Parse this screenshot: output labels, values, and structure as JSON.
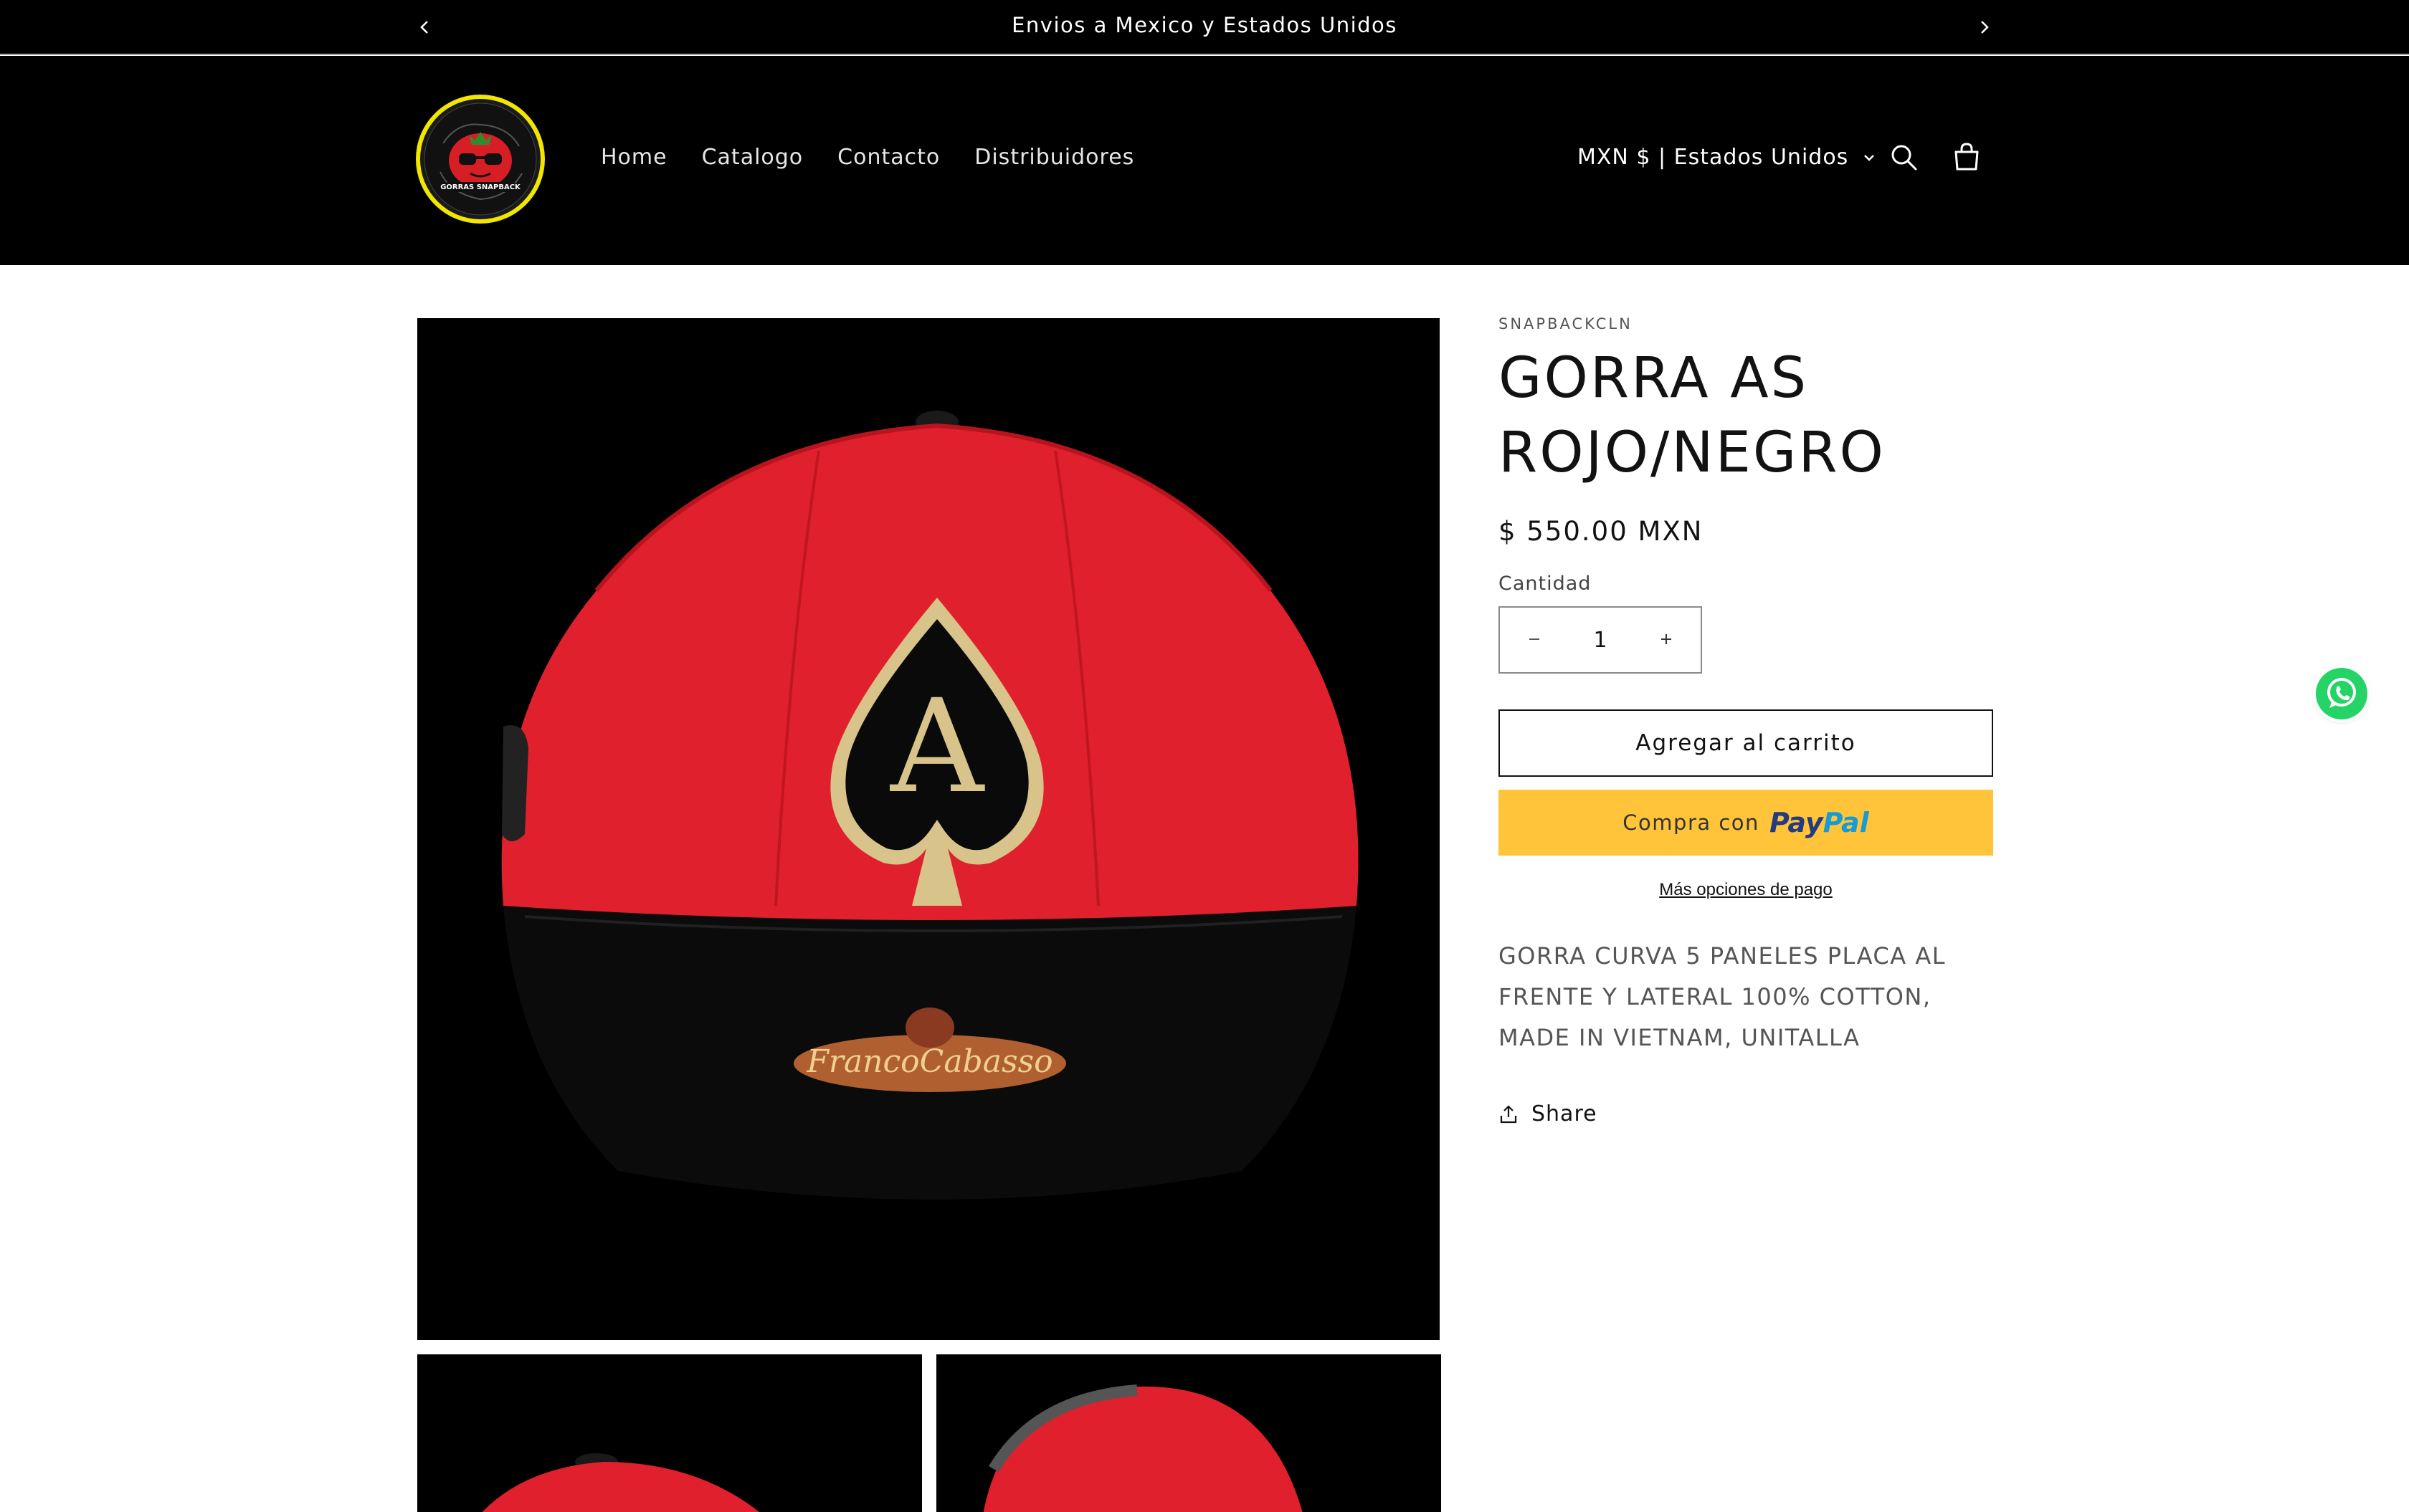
{
  "announcement": {
    "text": "Envios a Mexico y Estados Unidos"
  },
  "header": {
    "logo_alt": "Gorras Snapback",
    "nav": [
      {
        "label": "Home"
      },
      {
        "label": "Catalogo"
      },
      {
        "label": "Contacto"
      },
      {
        "label": "Distribuidores"
      }
    ],
    "locale": "MXN $ | Estados Unidos"
  },
  "product": {
    "vendor": "SNAPBACKCLN",
    "title": "GORRA AS ROJO/NEGRO",
    "price": "$ 550.00 MXN",
    "quantity_label": "Cantidad",
    "quantity": "1",
    "add_to_cart": "Agregar al carrito",
    "paypal_label": "Compra con",
    "paypal_brand_1": "Pay",
    "paypal_brand_2": "Pal",
    "more_options": "Más opciones de pago",
    "description": "GORRA CURVA 5 PANELES PLACA AL FRENTE Y LATERAL 100% COTTON, MADE IN VIETNAM, UNITALLA",
    "share": "Share"
  },
  "colors": {
    "header_bg": "#000000",
    "paypal_yellow": "#ffc439",
    "cap_red": "#e0202c",
    "whatsapp_green": "#25d366"
  }
}
